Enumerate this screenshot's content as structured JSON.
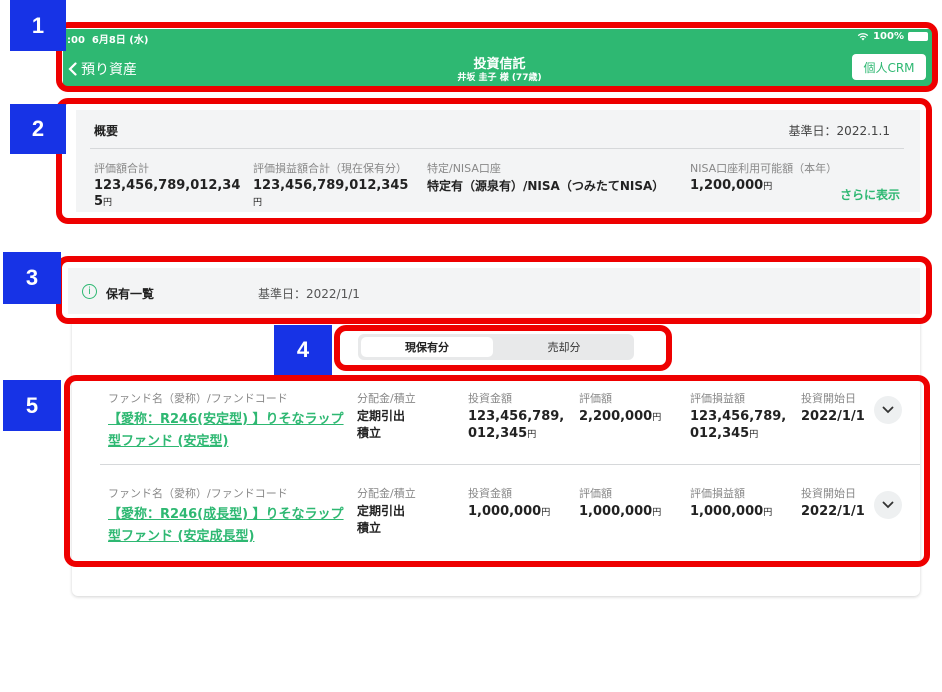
{
  "annotations": [
    "1",
    "2",
    "3",
    "4",
    "5"
  ],
  "status": {
    "time": ":00",
    "date": "6月8日 (水)",
    "battery": "100%"
  },
  "header": {
    "back_label": "預り資産",
    "title": "投資信託",
    "subtitle": "井坂 圭子 様 (77歳)",
    "crm_button": "個人CRM",
    "bg_color": "#2eb872"
  },
  "overview": {
    "title": "概要",
    "date": "基準日：2022.1.1",
    "items": [
      {
        "label": "評価額合計",
        "value_line1": "123,456,789,012,34",
        "value_line2": "5",
        "unit": "円"
      },
      {
        "label": "評価損益額合計（現在保有分）",
        "value_line1": "123,456,789,012,345",
        "value_line2": "",
        "unit": "円"
      },
      {
        "label": "特定/NISA口座",
        "value_line1": "特定有（源泉有）/NISA（つみたてNISA）",
        "value_line2": "",
        "unit": ""
      },
      {
        "label": "NISA口座利用可能額（本年）",
        "value_line1": "1,200,000",
        "value_line2": "",
        "unit": "円"
      }
    ],
    "more_link": "さらに表示"
  },
  "holdings": {
    "title": "保有一覧",
    "date": "基準日：2022/1/1",
    "tabs": [
      "現保有分",
      "売却分"
    ],
    "active_tab": 0
  },
  "columns": {
    "fund": "ファンド名（愛称）/ファンドコード",
    "distribution": "分配金/積立",
    "investment": "投資金額",
    "valuation": "評価額",
    "pnl": "評価損益額",
    "start": "投資開始日"
  },
  "funds": [
    {
      "name_line1": "【愛称：R246(安定型) 】りそなラップ",
      "name_line2": "型ファンド (安定型)",
      "distribution_line1": "定期引出",
      "distribution_line2": "積立",
      "investment_line1": "123,456,789,",
      "investment_line2": "012,345",
      "valuation": "2,200,000",
      "pnl_line1": "123,456,789,",
      "pnl_line2": "012,345",
      "start": "2022/1/1",
      "unit": "円"
    },
    {
      "name_line1": "【愛称：R246(成長型) 】りそなラップ",
      "name_line2": "型ファンド (安定成長型)",
      "distribution_line1": "定期引出",
      "distribution_line2": "積立",
      "investment_line1": "1,000,000",
      "investment_line2": "",
      "valuation": "1,000,000",
      "pnl_line1": "1,000,000",
      "pnl_line2": "",
      "start": "2022/1/1",
      "unit": "円"
    }
  ]
}
